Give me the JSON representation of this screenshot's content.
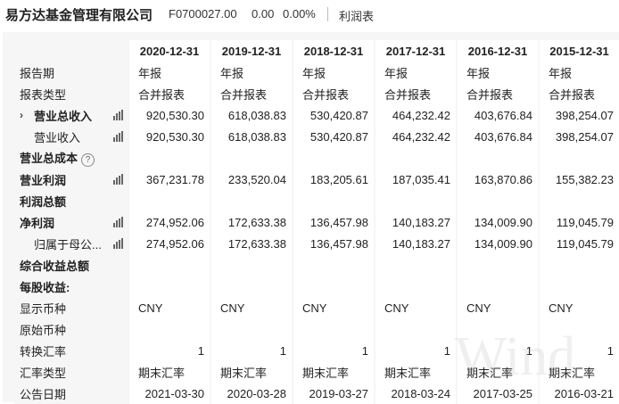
{
  "header": {
    "company": "易方达基金管理有限公司",
    "code": "F0700027.00",
    "price": "0.00",
    "change": "0.00%",
    "tab": "利润表"
  },
  "columns": [
    "2020-12-31",
    "2019-12-31",
    "2018-12-31",
    "2017-12-31",
    "2016-12-31",
    "2015-12-31"
  ],
  "rows": [
    {
      "label": "报告期",
      "values": [
        "年报",
        "年报",
        "年报",
        "年报",
        "年报",
        "年报"
      ]
    },
    {
      "label": "报表类型",
      "values": [
        "合并报表",
        "合并报表",
        "合并报表",
        "合并报表",
        "合并报表",
        "合并报表"
      ]
    },
    {
      "label": "营业总收入",
      "values": [
        "920,530.30",
        "618,038.83",
        "530,420.87",
        "464,232.42",
        "403,676.84",
        "398,254.07"
      ]
    },
    {
      "label": "营业收入",
      "values": [
        "920,530.30",
        "618,038.83",
        "530,420.87",
        "464,232.42",
        "403,676.84",
        "398,254.07"
      ]
    },
    {
      "label": "营业总成本",
      "values": [
        "",
        "",
        "",
        "",
        "",
        ""
      ]
    },
    {
      "label": "营业利润",
      "values": [
        "367,231.78",
        "233,520.04",
        "183,205.61",
        "187,035.41",
        "163,870.86",
        "155,382.23"
      ]
    },
    {
      "label": "利润总额",
      "values": [
        "",
        "",
        "",
        "",
        "",
        ""
      ]
    },
    {
      "label": "净利润",
      "values": [
        "274,952.06",
        "172,633.38",
        "136,457.98",
        "140,183.27",
        "134,009.90",
        "119,045.79"
      ]
    },
    {
      "label": "归属于母公...",
      "values": [
        "274,952.06",
        "172,633.38",
        "136,457.98",
        "140,183.27",
        "134,009.90",
        "119,045.79"
      ]
    },
    {
      "label": "综合收益总额",
      "values": [
        "",
        "",
        "",
        "",
        "",
        ""
      ]
    },
    {
      "label": "每股收益:",
      "values": [
        "",
        "",
        "",
        "",
        "",
        ""
      ]
    },
    {
      "label": "显示币种",
      "values": [
        "CNY",
        "CNY",
        "CNY",
        "CNY",
        "CNY",
        "CNY"
      ]
    },
    {
      "label": "原始币种",
      "values": [
        "",
        "",
        "",
        "",
        "",
        ""
      ]
    },
    {
      "label": "转换汇率",
      "values": [
        "1",
        "1",
        "1",
        "1",
        "1",
        "1"
      ]
    },
    {
      "label": "汇率类型",
      "values": [
        "期末汇率",
        "期末汇率",
        "期末汇率",
        "期末汇率",
        "期末汇率",
        "期末汇率"
      ]
    },
    {
      "label": "公告日期",
      "values": [
        "2021-03-30",
        "2020-03-28",
        "2019-03-27",
        "2018-03-24",
        "2017-03-25",
        "2016-03-21"
      ]
    }
  ],
  "icons": {
    "expand": "chevron-right-icon",
    "chart": "bar-chart-icon",
    "help": "question-circle-icon"
  },
  "watermark": "Wind"
}
